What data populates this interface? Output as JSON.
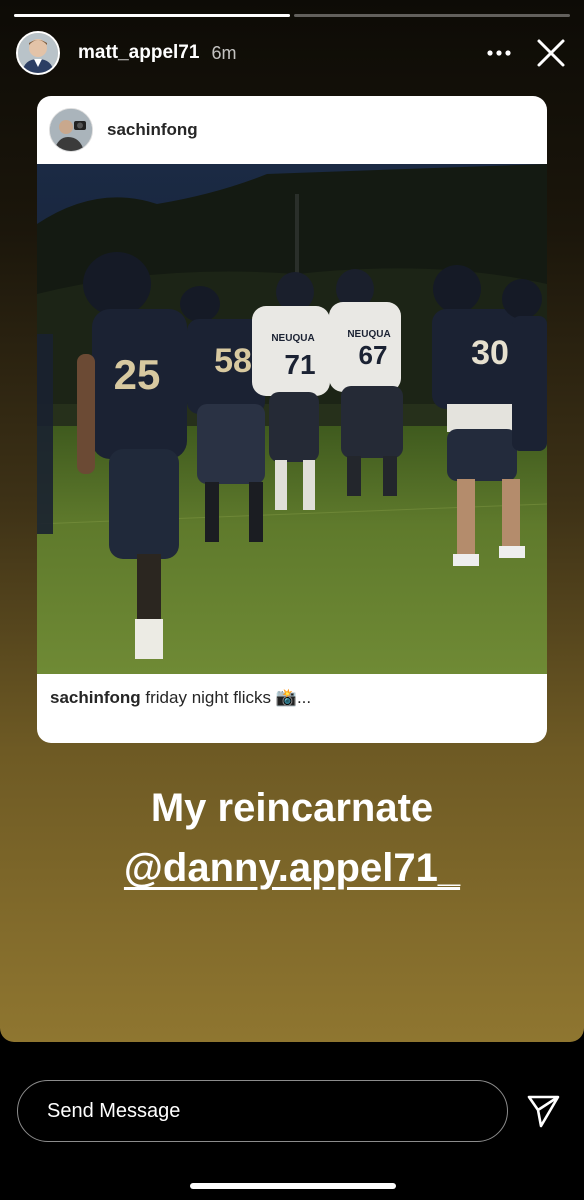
{
  "story": {
    "progress": [
      1.0,
      0.0
    ],
    "author": {
      "username": "matt_appel71",
      "time": "6m"
    },
    "icons": {
      "more": "more-horizontal-icon",
      "close": "close-icon"
    },
    "shared_post": {
      "username": "sachinfong",
      "caption_username": "sachinfong",
      "caption_text": " friday night flicks 📸...",
      "multi_image_icon": "carousel-icon",
      "photo_jerseys": [
        "25",
        "58",
        "71",
        "67",
        "30"
      ],
      "photo_jersey_text": "NEUQUA"
    },
    "text": {
      "line1": "My reincarnate",
      "mention": "@danny.appel71_"
    }
  },
  "reply_bar": {
    "placeholder": "Send Message",
    "send_icon": "paper-plane-icon"
  }
}
